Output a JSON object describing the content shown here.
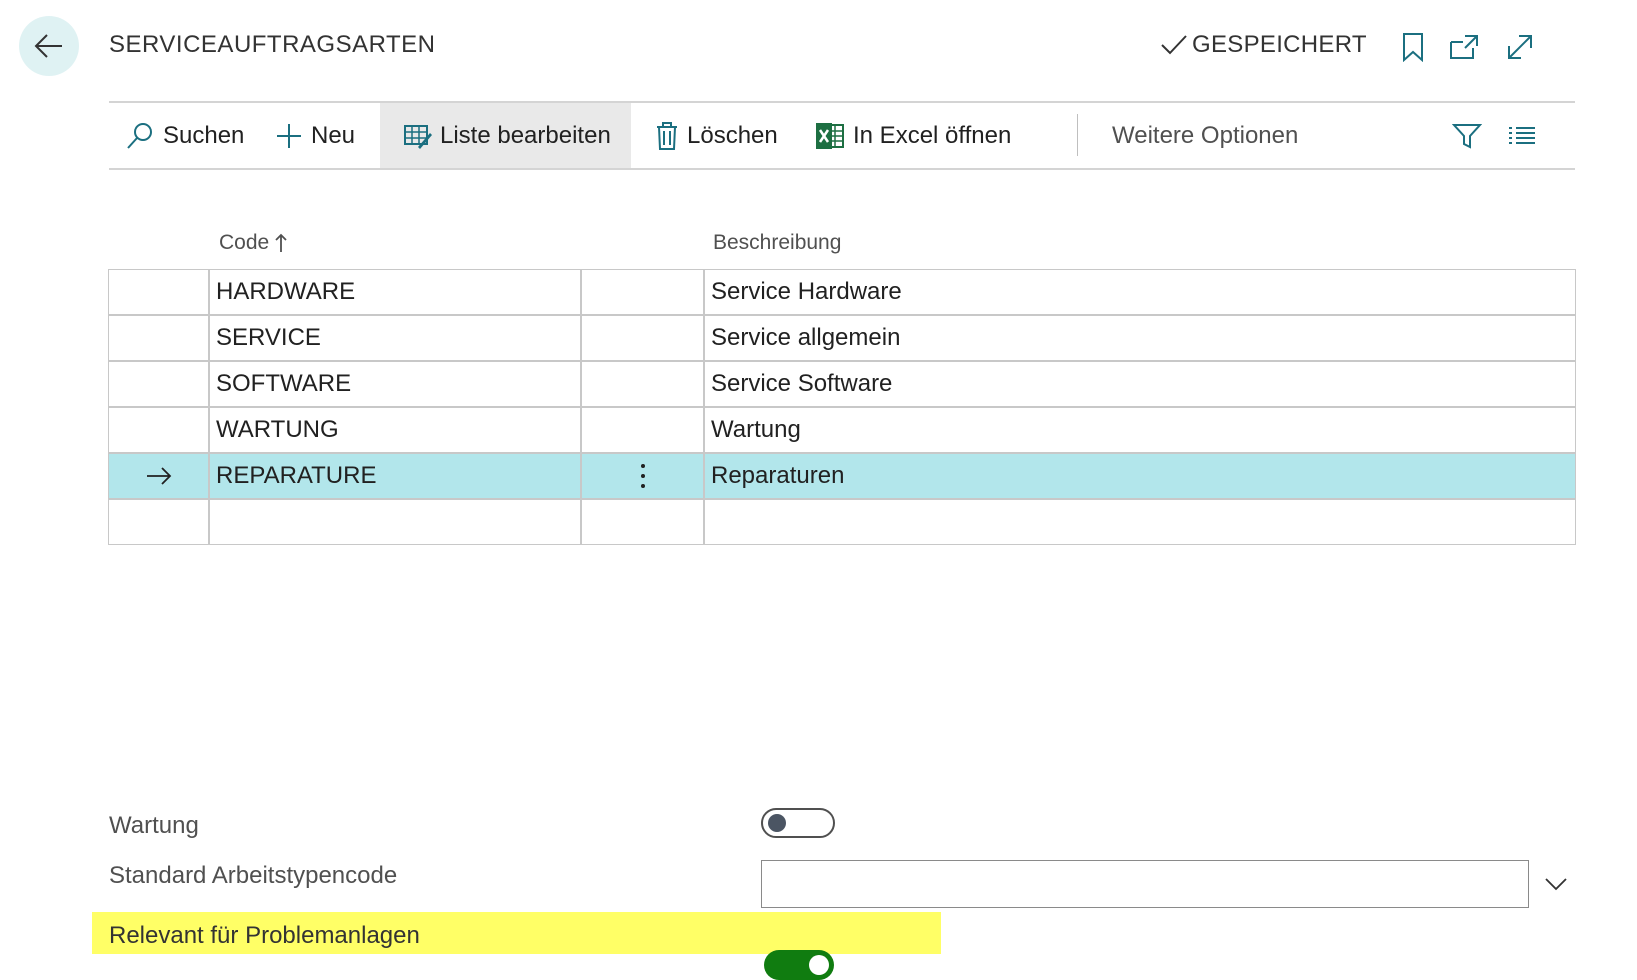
{
  "header": {
    "title": "SERVICEAUFTRAGSARTEN",
    "status": "GESPEICHERT"
  },
  "actions": {
    "search": "Suchen",
    "new": "Neu",
    "edit_list": "Liste bearbeiten",
    "delete": "Löschen",
    "excel": "In Excel öffnen",
    "more": "Weitere Optionen"
  },
  "grid": {
    "columns": {
      "code": "Code",
      "description": "Beschreibung"
    },
    "rows": [
      {
        "code": "HARDWARE",
        "description": "Service Hardware"
      },
      {
        "code": "SERVICE",
        "description": "Service allgemein"
      },
      {
        "code": "SOFTWARE",
        "description": "Service Software"
      },
      {
        "code": "WARTUNG",
        "description": "Wartung"
      },
      {
        "code": "REPARATURE",
        "description": "Reparaturen",
        "selected": true
      },
      {
        "code": "",
        "description": ""
      }
    ]
  },
  "fields": {
    "maintenance_label": "Wartung",
    "maintenance_value": false,
    "work_type_label": "Standard Arbeitstypencode",
    "work_type_value": "",
    "relevant_label": "Relevant für Problemanlagen",
    "relevant_value": true
  },
  "colors": {
    "accent": "#107c10",
    "selected_row": "#b2e6eb",
    "highlight": "#ffff66",
    "back_button": "#dff2f3",
    "excel_green": "#1d6f42"
  }
}
